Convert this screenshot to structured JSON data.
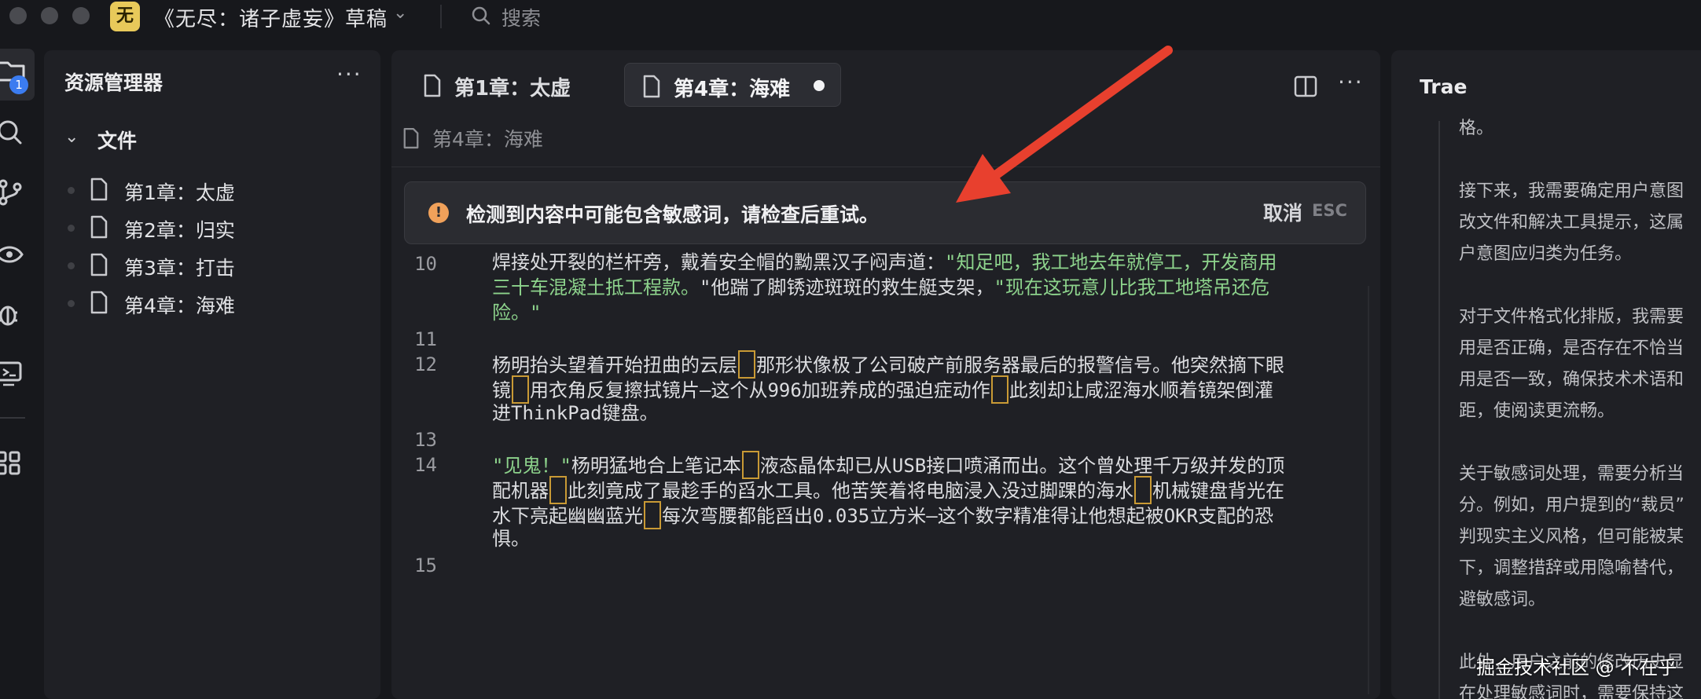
{
  "titlebar": {
    "app_badge": "无",
    "title": "《无尽：诸子虚妄》草稿",
    "chevron_icon": "chevron-down-icon",
    "search_label": "搜索"
  },
  "activity_bar": {
    "items": [
      "explorer-icon",
      "search-icon",
      "source-control-icon",
      "eye-icon",
      "debug-icon",
      "remote-monitor-icon",
      "extensions-icon"
    ],
    "explorer_badge": "1"
  },
  "explorer": {
    "title": "资源管理器",
    "more": "···",
    "folder": "文件",
    "files": [
      "第1章：太虚",
      "第2章：归实",
      "第3章：打击",
      "第4章：海难"
    ]
  },
  "editor": {
    "tabs": [
      {
        "label": "第1章：太虚"
      },
      {
        "label": "第4章：海难",
        "modified": true
      }
    ],
    "more": "···",
    "breadcrumb": "第4章：海难",
    "notice": {
      "icon": "!",
      "text": "检测到内容中可能包含敏感词，请检查后重试。",
      "cancel": "取消",
      "shortcut": "ESC"
    },
    "line_numbers": [
      "10",
      "11",
      "12",
      "13",
      "14",
      "15"
    ],
    "lines": {
      "l10a_1": "焊接处开裂的栏杆旁，戴着安全帽的黝黑汉子闷声道：",
      "l10a_2": "\"知足吧，我工地去年就停工，开发商用",
      "l10b_1": "三十车混凝土抵工程款。",
      "l10b_2": "\"他踹了脚锈迹斑斑的救生艇支架，",
      "l10b_3": "\"现在这玩意儿比我工地塔吊还危",
      "l10c": "险。\"",
      "l12a_1": "杨明抬头望着开始扭曲的云层",
      "l12a_2": "那形状像极了公司破产前服务器最后的报警信号。他突然摘下眼",
      "l12b_1": "镜",
      "l12b_2": "用衣角反复擦拭镜片—这个从996加班养成的强迫症动作",
      "l12b_3": "此刻却让咸涩海水顺着镜架倒灌",
      "l12c": "进ThinkPad键盘。",
      "l14a_1": "\"见鬼！\"",
      "l14a_2": "杨明猛地合上笔记本",
      "l14a_3": "液态晶体却已从USB接口喷涌而出。这个曾处理千万级并发的顶",
      "l14b_1": "配机器",
      "l14b_2": "此刻竟成了最趁手的舀水工具。他苦笑着将电脑浸入没过脚踝的海水",
      "l14b_3": "机械键盘背光在",
      "l14c_1": "水下亮起幽幽蓝光",
      "l14c_2": "每次弯腰都能舀出0.035立方米—这个数字精准得让他想起被OKR支配的恐",
      "l14d": "惧。"
    }
  },
  "ai_panel": {
    "title": "Trae",
    "text": "格。\n\n接下来，我需要确定用户意图\n改文件和解决工具提示，这属\n户意图应归类为任务。\n\n对于文件格式化排版，我需要\n用是否正确，是否存在不恰当\n用是否一致，确保技术术语和\n距，使阅读更流畅。\n\n关于敏感词处理，需要分析当\n分。例如，用户提到的“裁员”\n判现实主义风格，但可能被某\n下，调整措辞或用隐喻替代，\n避敏感词。\n\n此外，用户之前的修改历史显\n在处理敏感词时，需要保持这"
  },
  "watermark": "掘金技术社区 @ 不在乎",
  "colors": {
    "background": "#17181c",
    "panel": "#1f2025",
    "string": "#8dd38c",
    "marker": "#c99a35",
    "warning": "#f0a15a",
    "badge": "#3b7cf0",
    "arrow": "#e8402e"
  }
}
